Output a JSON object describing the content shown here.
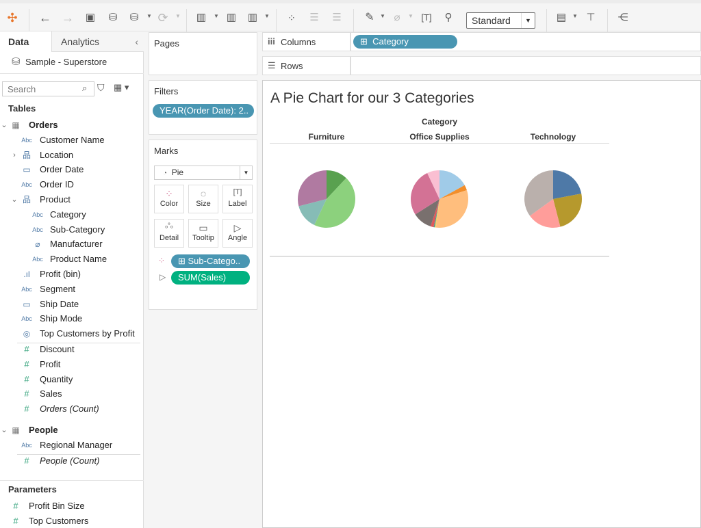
{
  "toolbar": {
    "view_size": "Standard",
    "icons": [
      "tableau-logo",
      "undo",
      "redo",
      "save",
      "new-data-source",
      "pause-updates",
      "refresh",
      "new-worksheet",
      "duplicate-sheet",
      "clear-sheet",
      "swap-rows-columns",
      "sort-ascending",
      "sort-descending",
      "highlight",
      "group-members",
      "show-labels",
      "fix-axes",
      "fit-dropdown",
      "show-me",
      "presentation-mode",
      "share"
    ]
  },
  "left": {
    "tabs": [
      "Data",
      "Analytics"
    ],
    "datasource": "Sample - Superstore",
    "search_placeholder": "Search",
    "tables_label": "Tables",
    "fields": [
      {
        "name": "Orders",
        "type": "table",
        "level": 0,
        "bold": true,
        "chevron": "down"
      },
      {
        "name": "Customer Name",
        "type": "abc",
        "level": 1
      },
      {
        "name": "Location",
        "type": "hierarchy",
        "level": 1,
        "chevron": "right"
      },
      {
        "name": "Order Date",
        "type": "date",
        "level": 1
      },
      {
        "name": "Order ID",
        "type": "abc",
        "level": 1
      },
      {
        "name": "Product",
        "type": "hierarchy",
        "level": 1,
        "chevron": "down"
      },
      {
        "name": "Category",
        "type": "abc",
        "level": 2
      },
      {
        "name": "Sub-Category",
        "type": "abc",
        "level": 2
      },
      {
        "name": "Manufacturer",
        "type": "clip",
        "level": 2
      },
      {
        "name": "Product Name",
        "type": "abc",
        "level": 2
      },
      {
        "name": "Profit (bin)",
        "type": "bin",
        "level": 1
      },
      {
        "name": "Segment",
        "type": "abc",
        "level": 1
      },
      {
        "name": "Ship Date",
        "type": "date",
        "level": 1
      },
      {
        "name": "Ship Mode",
        "type": "abc",
        "level": 1
      },
      {
        "name": "Top Customers by Profit",
        "type": "set",
        "level": 1,
        "sep": true
      },
      {
        "name": "Discount",
        "type": "measure",
        "level": 1
      },
      {
        "name": "Profit",
        "type": "measure",
        "level": 1
      },
      {
        "name": "Quantity",
        "type": "measure",
        "level": 1
      },
      {
        "name": "Sales",
        "type": "measure",
        "level": 1
      },
      {
        "name": "Orders (Count)",
        "type": "measure",
        "level": 1,
        "italic": true,
        "gap": true
      },
      {
        "name": "People",
        "type": "table",
        "level": 0,
        "bold": true,
        "chevron": "down"
      },
      {
        "name": "Regional Manager",
        "type": "abc",
        "level": 1,
        "sep": true
      },
      {
        "name": "People (Count)",
        "type": "measure",
        "level": 1,
        "italic": true
      }
    ],
    "parameters_label": "Parameters",
    "parameters": [
      "Profit Bin Size",
      "Top Customers"
    ]
  },
  "cards": {
    "pages": "Pages",
    "filters": "Filters",
    "filter_pill": "YEAR(Order Date): 2..",
    "marks": "Marks",
    "mark_type": "Pie",
    "mark_buttons": [
      "Color",
      "Size",
      "Label",
      "Detail",
      "Tooltip",
      "Angle"
    ],
    "color_pill": "Sub-Catego..",
    "angle_pill": "SUM(Sales)"
  },
  "shelves": {
    "columns": "Columns",
    "rows": "Rows",
    "columns_pill": "Category"
  },
  "colors": {
    "dimension_pill": "#4996b2",
    "measure_pill": "#00b180"
  },
  "chart_data": {
    "type": "pie",
    "title": "A Pie Chart for our 3 Categories",
    "column_header": "Category",
    "panes": [
      {
        "label": "Furniture",
        "slices": [
          {
            "value": 12,
            "color": "#59a14f"
          },
          {
            "value": 45,
            "color": "#8cd17d"
          },
          {
            "value": 14,
            "color": "#86bcb6"
          },
          {
            "value": 29,
            "color": "#b07aa1"
          }
        ]
      },
      {
        "label": "Office Supplies",
        "slices": [
          {
            "value": 17,
            "color": "#a0cbe8"
          },
          {
            "value": 3,
            "color": "#f28e2b"
          },
          {
            "value": 32,
            "color": "#ffbe7d"
          },
          {
            "value": 0.7,
            "color": "#f1ce63"
          },
          {
            "value": 0.6,
            "color": "#499894"
          },
          {
            "value": 1.7,
            "color": "#e15759"
          },
          {
            "value": 11,
            "color": "#79706e"
          },
          {
            "value": 27,
            "color": "#d37295"
          },
          {
            "value": 7,
            "color": "#fabfd2"
          }
        ]
      },
      {
        "label": "Technology",
        "slices": [
          {
            "value": 22,
            "color": "#4e79a7"
          },
          {
            "value": 24,
            "color": "#b6992d"
          },
          {
            "value": 19,
            "color": "#ff9d9a"
          },
          {
            "value": 35,
            "color": "#bab0ac"
          }
        ]
      }
    ]
  }
}
